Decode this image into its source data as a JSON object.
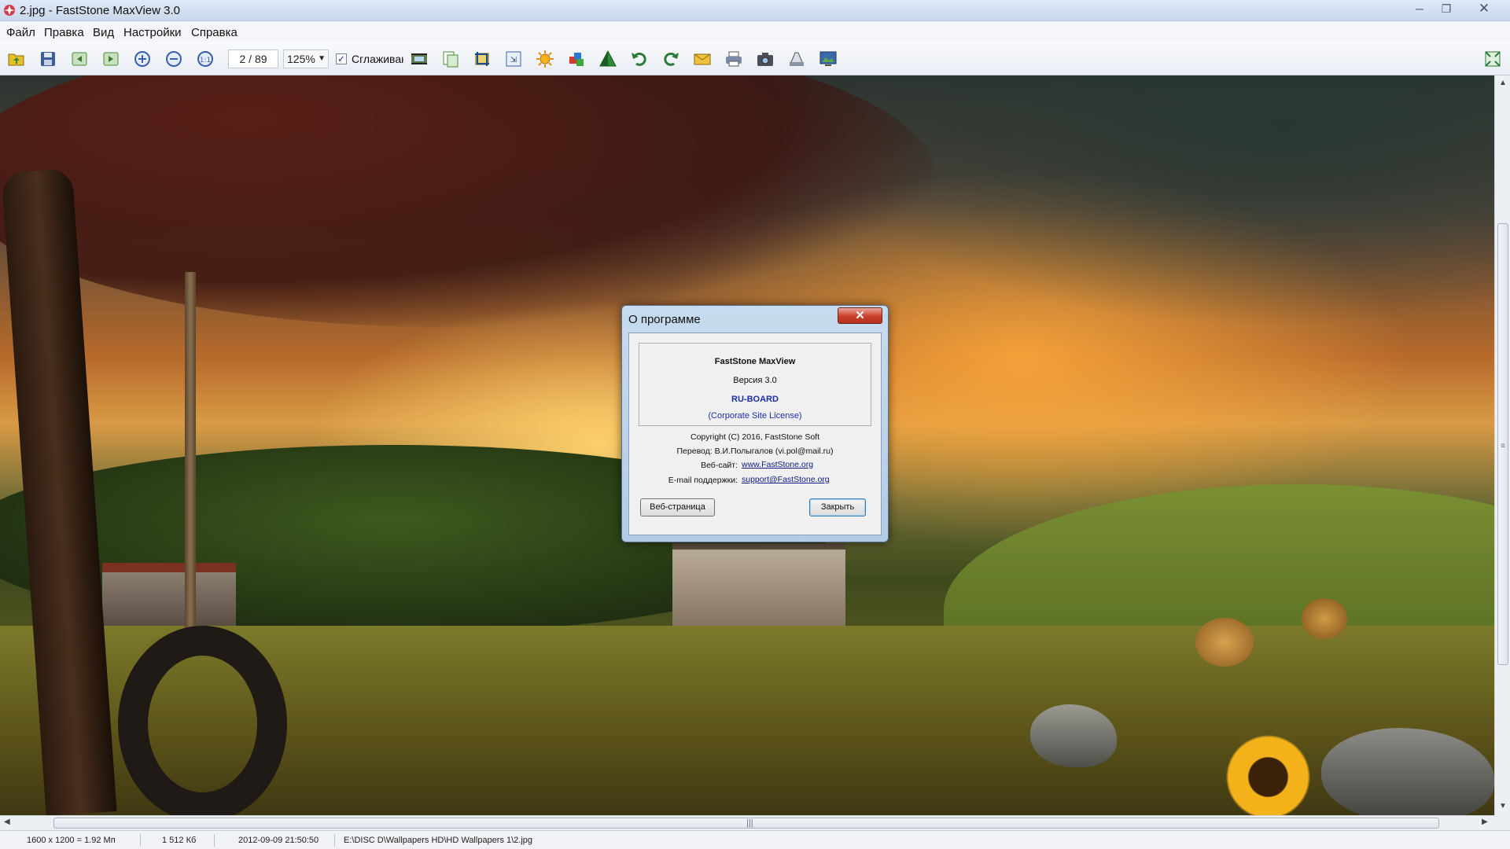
{
  "window": {
    "title": "2.jpg - FastStone MaxView 3.0",
    "controls": {
      "minimize": "─",
      "maximize": "❐",
      "close": "✕"
    }
  },
  "menu": {
    "items": [
      "Файл",
      "Правка",
      "Вид",
      "Настройки",
      "Справка"
    ]
  },
  "toolbar": {
    "page_counter": "2 / 89",
    "zoom": "125%",
    "zoom_arrow": "▼",
    "smooth_checked": "✓",
    "smooth_label": "Сглаживание",
    "icons": [
      "open-folder-icon",
      "save-icon",
      "previous-icon",
      "next-icon",
      "zoom-in-icon",
      "zoom-out-icon",
      "actual-size-icon",
      "slideshow-icon",
      "copy-to-icon",
      "crop-icon",
      "resize-icon",
      "brightness-icon",
      "colors-icon",
      "sharpen-icon",
      "rotate-left-icon",
      "rotate-right-icon",
      "email-icon",
      "print-icon",
      "camera-icon",
      "scan-icon",
      "wallpaper-icon",
      "fullscreen-icon"
    ]
  },
  "scrollbar": {
    "up": "▲",
    "down": "▼",
    "left": "◀",
    "right": "▶",
    "grip_v": "≡",
    "grip_h": "|||"
  },
  "status": {
    "dimensions": "1600 x 1200 = 1.92 Мп",
    "filesize": "1 512 Кб",
    "datetime": "2012-09-09 21:50:50",
    "path": "E:\\DISC D\\Wallpapers HD\\HD Wallpapers 1\\2.jpg"
  },
  "dialog": {
    "title": "О программе",
    "close": "✕",
    "product": "FastStone MaxView",
    "version": "Версия 3.0",
    "licensee": "RU-BOARD",
    "license_type": "(Corporate Site License)",
    "copyright": "Copyright (C) 2016, FastStone Soft",
    "translation": "Перевод: В.И.Полыгалов (vi.pol@mail.ru)",
    "site_label": "Веб-сайт:",
    "site_url": "www.FastStone.org",
    "email_label": "E-mail поддержки:",
    "email": "support@FastStone.org",
    "web_button": "Веб-страница",
    "close_button": "Закрыть"
  },
  "colors": {
    "dialog_close": "#c8402a",
    "link": "#0d1a8a",
    "licensee": "#1c2fa8"
  }
}
